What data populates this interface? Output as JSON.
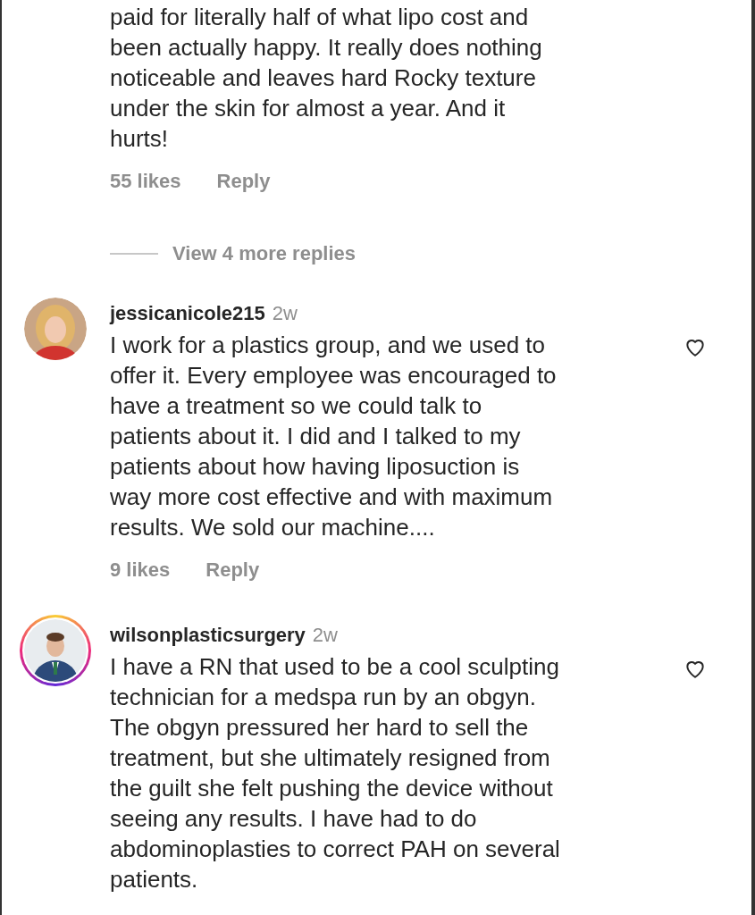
{
  "items": [
    {
      "kind": "comment",
      "lines": [
        "paid for literally half of what lipo cost and",
        "been actually happy. It really does nothing",
        "noticeable and leaves hard Rocky texture",
        "under the skin for almost a year. And it",
        "hurts!"
      ],
      "likes": "55 likes",
      "reply": "Reply"
    },
    {
      "kind": "view_replies",
      "label": "View 4 more replies"
    },
    {
      "kind": "comment",
      "avatar": {
        "kind": "woman"
      },
      "story": false,
      "username": "jessicanicole215",
      "time": "2w",
      "liked": false,
      "lines": [
        "I work for a plastics group, and we used to",
        "offer it. Every employee was encouraged to",
        "have a treatment so we could talk to",
        "patients about it. I did and I talked to my",
        "patients about how having liposuction is",
        "way more cost effective and with maximum",
        "results. We sold our machine...."
      ],
      "likes": "9 likes",
      "reply": "Reply"
    },
    {
      "kind": "comment",
      "avatar": {
        "kind": "man"
      },
      "story": true,
      "username": "wilsonplasticsurgery",
      "time": "2w",
      "liked": false,
      "lines": [
        "I have a RN that used to be a cool sculpting",
        "technician for a medspa run by an obgyn.",
        "The obgyn pressured her hard to sell the",
        "treatment, but she ultimately resigned from",
        "the guilt she felt pushing the device without",
        "seeing any results.  I have had to do",
        "abdominoplasties to correct PAH on several",
        "patients."
      ]
    }
  ]
}
